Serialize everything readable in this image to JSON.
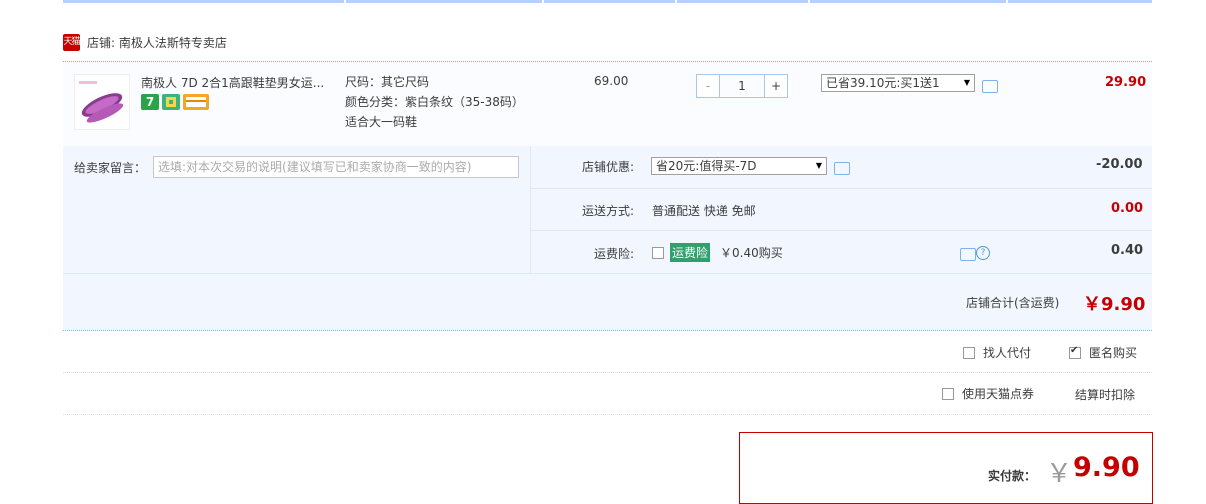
{
  "shop": {
    "badge": "天猫",
    "label": "店铺: 南极人法斯特专卖店"
  },
  "item": {
    "title": "南极人 7D 2合1高跟鞋垫男女运...",
    "badges": [
      "7"
    ],
    "sku": [
      "尺码：其它尺码",
      "颜色分类：紫白条纹（35-38码）",
      "适合大一码鞋"
    ],
    "unit_price": "69.00",
    "qty": {
      "minus": "-",
      "value": "1",
      "plus": "+"
    },
    "promo_select": "已省39.10元:买1送1",
    "subtotal": "29.90"
  },
  "message": {
    "label": "给卖家留言：",
    "placeholder": "选填:对本次交易的说明(建议填写已和卖家协商一致的内容)"
  },
  "shop_discount": {
    "label": "店铺优惠:",
    "select": "省20元:值得买-7D",
    "amount": "-20.00"
  },
  "shipping": {
    "label": "运送方式:",
    "value": "普通配送 快递 免邮",
    "amount": "0.00"
  },
  "insurance": {
    "label": "运费险:",
    "tag": "运费险",
    "price": "￥0.40购买",
    "amount": "0.40",
    "help": "?"
  },
  "shop_total": {
    "label": "店铺合计(含运费)",
    "value": "￥9.90"
  },
  "options": {
    "proxy_pay": "找人代付",
    "anonymous": "匿名购买",
    "points": "使用天猫点券",
    "points_note": "结算时扣除"
  },
  "checkmark": "✔",
  "final": {
    "label": "实付款：",
    "currency": "￥",
    "value": "9.90"
  },
  "colors": {
    "accent_red": "#c40000",
    "border_blue": "#b2d1ff",
    "panel_bg": "#f2f7ff"
  }
}
